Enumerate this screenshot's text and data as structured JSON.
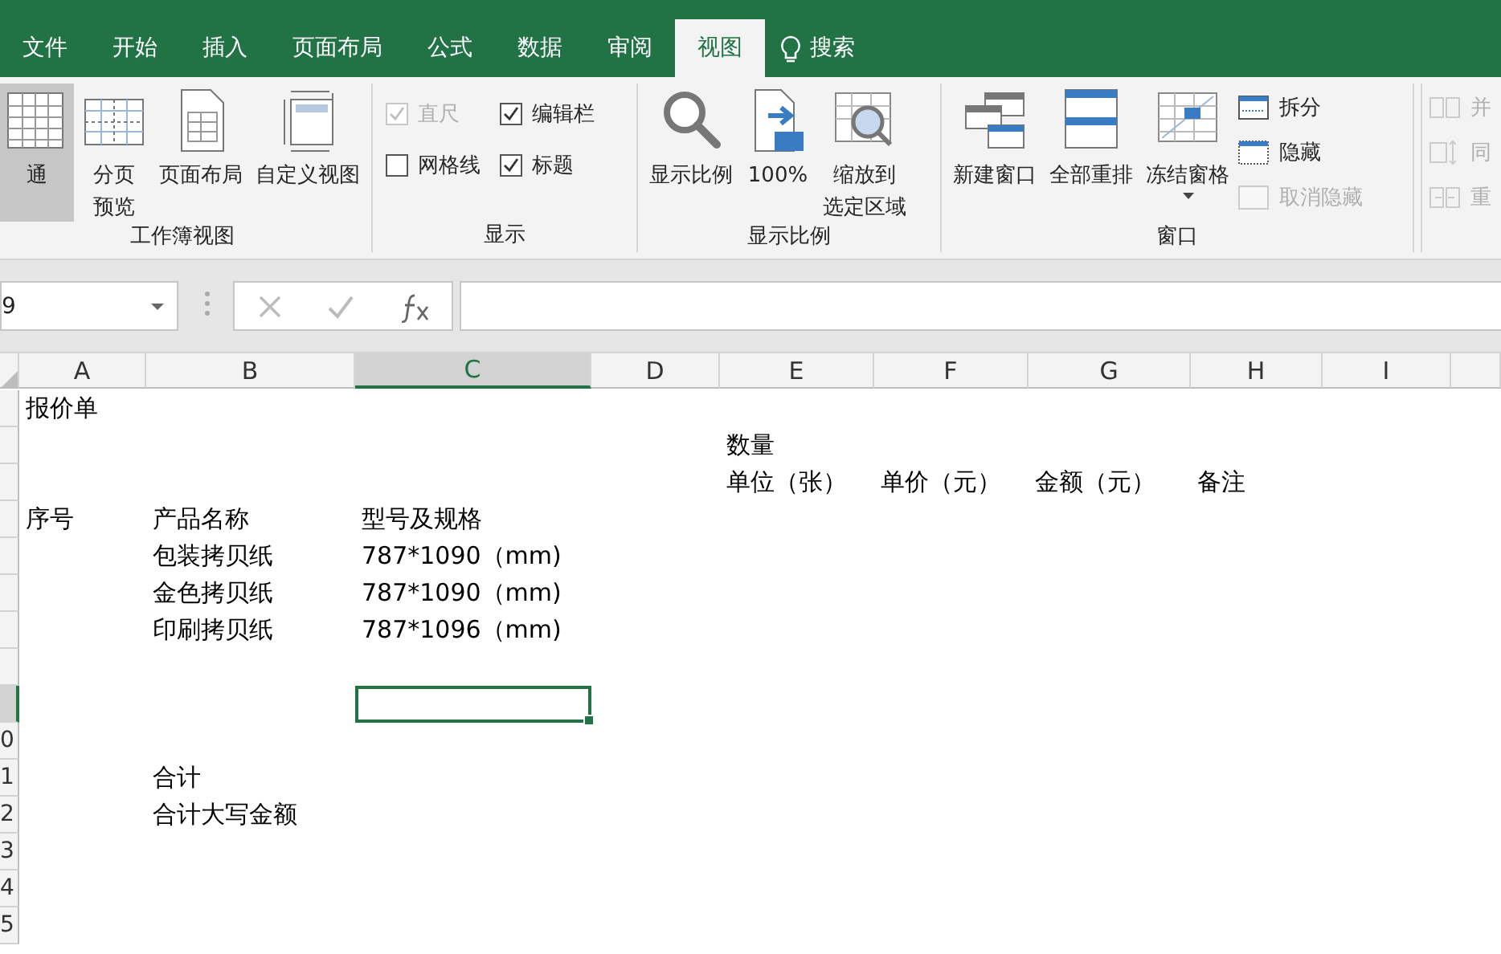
{
  "tabs": [
    {
      "label": "文件",
      "selected": false
    },
    {
      "label": "开始",
      "selected": false
    },
    {
      "label": "插入",
      "selected": false
    },
    {
      "label": "页面布局",
      "selected": false
    },
    {
      "label": "公式",
      "selected": false
    },
    {
      "label": "数据",
      "selected": false
    },
    {
      "label": "审阅",
      "selected": false
    },
    {
      "label": "视图",
      "selected": true
    }
  ],
  "search": {
    "label": "搜索"
  },
  "ribbon": {
    "groups": [
      {
        "label": "工作簿视图",
        "items": [
          {
            "kind": "large",
            "label": "通",
            "selected": true
          },
          {
            "kind": "large",
            "label": [
              "分页",
              "预览"
            ],
            "selected": false
          },
          {
            "kind": "large",
            "label": "页面布局",
            "selected": false
          },
          {
            "kind": "large",
            "label": "自定义视图",
            "selected": false
          }
        ]
      },
      {
        "label": "显示",
        "items": [
          {
            "kind": "check",
            "label": "直尺",
            "checked": true,
            "disabled": true
          },
          {
            "kind": "check",
            "label": "编辑栏",
            "checked": true,
            "disabled": false
          },
          {
            "kind": "check",
            "label": "网格线",
            "checked": false,
            "disabled": false
          },
          {
            "kind": "check",
            "label": "标题",
            "checked": true,
            "disabled": false
          }
        ]
      },
      {
        "label": "显示比例",
        "items": [
          {
            "kind": "large",
            "label": "显示比例",
            "selected": false
          },
          {
            "kind": "large",
            "label": "100%",
            "selected": false
          },
          {
            "kind": "large",
            "label": [
              "缩放到",
              "选定区域"
            ],
            "selected": false
          }
        ]
      },
      {
        "label": "窗口",
        "items": [
          {
            "kind": "large",
            "label": "新建窗口",
            "selected": false
          },
          {
            "kind": "large",
            "label": "全部重排",
            "selected": false
          },
          {
            "kind": "large",
            "label": "冻结窗格",
            "selected": false,
            "dropdown": true
          },
          {
            "kind": "small",
            "label": "拆分",
            "disabled": false
          },
          {
            "kind": "small",
            "label": "隐藏",
            "disabled": false
          },
          {
            "kind": "small",
            "label": "取消隐藏",
            "disabled": true
          }
        ]
      },
      {
        "items": [
          {
            "kind": "small",
            "label": "并",
            "disabled": true
          },
          {
            "kind": "small",
            "label": "同",
            "disabled": true
          },
          {
            "kind": "small",
            "label": "重",
            "disabled": true
          }
        ]
      }
    ]
  },
  "formula_bar": {
    "name_box": "9"
  },
  "sheet": {
    "columns": [
      {
        "label": "A",
        "selected": false
      },
      {
        "label": "B",
        "selected": false
      },
      {
        "label": "C",
        "selected": true
      },
      {
        "label": "D",
        "selected": false
      },
      {
        "label": "E",
        "selected": false
      },
      {
        "label": "F",
        "selected": false
      },
      {
        "label": "G",
        "selected": false
      },
      {
        "label": "H",
        "selected": false
      },
      {
        "label": "I",
        "selected": false
      }
    ],
    "rows": [
      {
        "selected": false,
        "cells": [
          {
            "text": "报价单"
          }
        ]
      },
      {
        "selected": false,
        "cells": [
          null,
          null,
          null,
          null,
          {
            "text": "数量"
          }
        ]
      },
      {
        "selected": false,
        "cells": [
          null,
          null,
          null,
          null,
          {
            "text": "单位（张）"
          },
          {
            "text": "单价（元）"
          },
          {
            "text": "金额（元）"
          },
          {
            "text": "备注"
          }
        ]
      },
      {
        "selected": false,
        "cells": [
          {
            "text": "序号"
          },
          {
            "text": "产品名称"
          },
          {
            "text": "型号及规格"
          }
        ]
      },
      {
        "selected": false,
        "cells": [
          null,
          {
            "text": "包装拷贝纸"
          },
          {
            "text": "787*1090（mm)"
          }
        ]
      },
      {
        "selected": false,
        "cells": [
          null,
          {
            "text": "金色拷贝纸"
          },
          {
            "text": "787*1090（mm)"
          }
        ]
      },
      {
        "selected": false,
        "cells": [
          null,
          {
            "text": "印刷拷贝纸"
          },
          {
            "text": "787*1096（mm)"
          }
        ]
      },
      {
        "selected": false,
        "cells": []
      },
      {
        "selected": true,
        "cells": [
          null,
          null,
          {
            "selected": true
          }
        ]
      },
      {
        "label": "0",
        "selected": false,
        "cells": []
      },
      {
        "label": "1",
        "selected": false,
        "cells": [
          null,
          {
            "text": "合计"
          }
        ]
      },
      {
        "label": "2",
        "selected": false,
        "cells": [
          null,
          {
            "text": "合计大写金额"
          }
        ]
      },
      {
        "label": "3",
        "selected": false,
        "cells": []
      },
      {
        "label": "4",
        "selected": false,
        "cells": []
      },
      {
        "label": "5",
        "selected": false,
        "cells": []
      }
    ]
  }
}
